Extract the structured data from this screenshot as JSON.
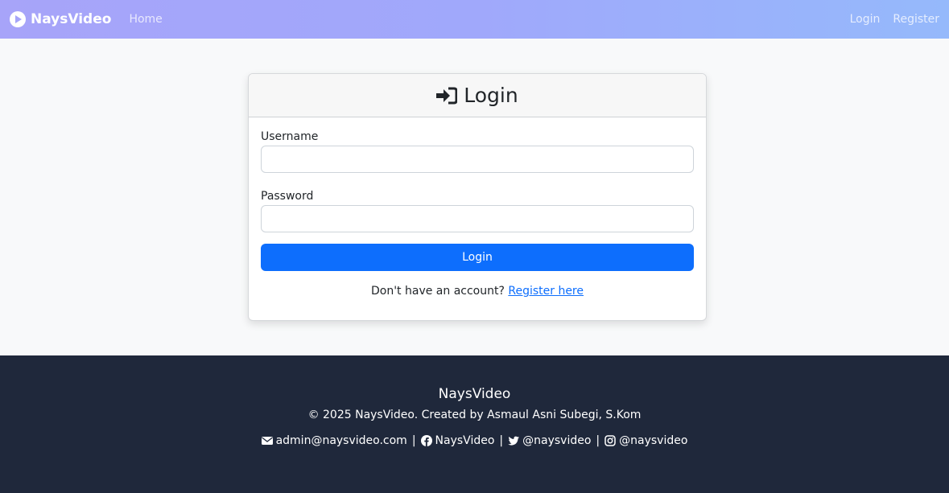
{
  "nav": {
    "brand": "NaysVideo",
    "home": "Home",
    "login": "Login",
    "register": "Register"
  },
  "card": {
    "title": "Login",
    "username_label": "Username",
    "username_value": "",
    "password_label": "Password",
    "password_value": "",
    "submit_label": "Login",
    "register_prompt": "Don't have an account?",
    "register_link": "Register here"
  },
  "footer": {
    "title": "NaysVideo",
    "copyright": "© 2025 NaysVideo. Created by Asmaul Asni Subegi, S.Kom",
    "email": "admin@naysvideo.com",
    "facebook": "NaysVideo",
    "twitter": "@naysvideo",
    "instagram": "@naysvideo",
    "separator": "|"
  },
  "colors": {
    "primary": "#0d6efd",
    "footer_bg": "#1f283b",
    "nav_gradient_start": "#a7a4f9",
    "nav_gradient_end": "#95b9fb"
  },
  "icons": {
    "brand": "play-circle-icon",
    "login": "sign-in-icon",
    "email": "envelope-icon",
    "facebook": "facebook-icon",
    "twitter": "twitter-icon",
    "instagram": "instagram-icon"
  }
}
